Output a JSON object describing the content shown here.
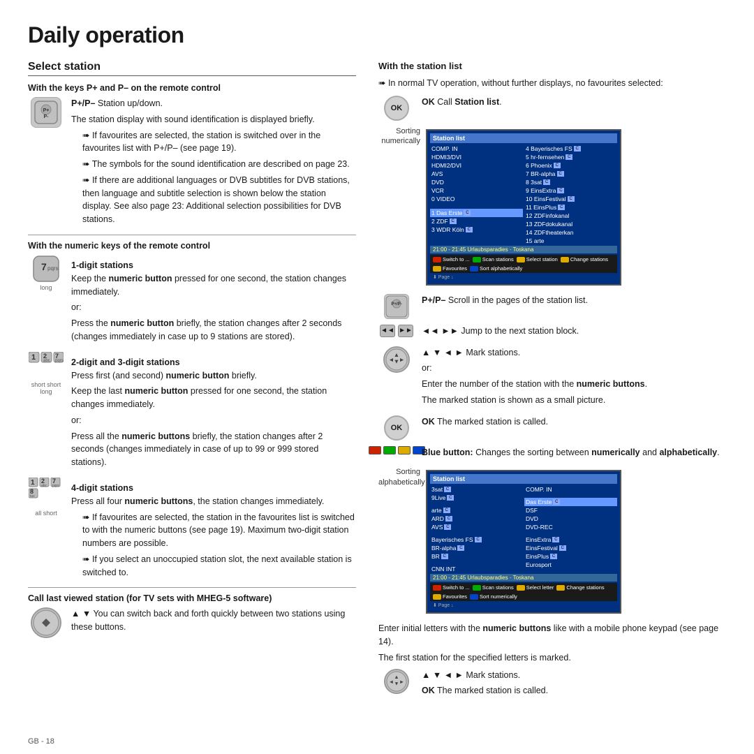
{
  "page": {
    "title": "Daily operation",
    "section": "Select station",
    "page_number": "GB - 18"
  },
  "left": {
    "keys_section_title": "With the keys P+ and P– on the remote control",
    "p_plus_minus": "P+/P–",
    "p_plus_minus_desc": " Station up/down.",
    "station_display": "The station display with sound identification is displayed briefly.",
    "bullet1": "If favourites are selected, the station is switched over in the favourites list with P+/P– (see page 19).",
    "bullet2": "The symbols for the sound identification are described on page 23.",
    "bullet3": "If there are additional languages or DVB subtitles for DVB stations, then language and subtitle selection is shown below the station display. See also page 23: Additional selection possibilities for DVB stations.",
    "numeric_section_title": "With the numeric keys of the remote control",
    "digit1_title": "1-digit stations",
    "digit1_desc1": "Keep the numeric button pressed for one second, the station changes immediately.",
    "digit1_or": "or:",
    "digit1_desc2": "Press the numeric button briefly, the station changes after 2 seconds (changes immediately in case up to 9 stations are stored).",
    "digit23_title": "2-digit and 3-digit stations",
    "digit23_desc1": "Press first (and second) numeric button briefly.",
    "digit23_desc2": "Keep the last numeric button pressed for one second, the station changes immediately.",
    "digit23_or": "or:",
    "digit23_desc3": "Press all the numeric buttons briefly, the station changes after 2 seconds (changes immediately in case of up to 99 or 999 stored stations).",
    "digit4_title": "4-digit stations",
    "digit4_desc1": "Press all four numeric buttons, the station changes immediately.",
    "digit4_bullet1": "If favourites are selected, the station in the favourites list is switched to with the numeric buttons (see page 19). Maximum two-digit station numbers are possible.",
    "digit4_bullet2": "If you select an unoccupied station slot, the next available station is switched to.",
    "call_last_title": "Call last viewed station (for TV sets with MHEG-5 software)",
    "call_last_desc": "You can switch back and forth quickly between two stations using these buttons."
  },
  "right": {
    "station_list_title": "With the station list",
    "normal_tv_desc": "In normal TV operation, without further displays, no favourites selected:",
    "ok_call": "OK",
    "ok_call_desc": "Call Station list.",
    "sorting_numerically": "Sorting\nnumerically",
    "station_list_screen1": {
      "header": "Station list",
      "left_col": [
        "COMP. IN",
        "HDMI3/DVI",
        "HDMI2/DVI",
        "AVS",
        "DVD",
        "VCR",
        "0 VIDEO",
        "",
        "1 Das Erste",
        "2 ZDF",
        "3 WDR Köln"
      ],
      "right_col": [
        "4 Bayerisches FS",
        "5 hr-fernsehen",
        "6 Phoenix",
        "7 BR-alpha",
        "8 3sat",
        "9 EinsExtra",
        "10 EinsFestival",
        "11 EinsPlus",
        "12 ZDFinfokanal",
        "13 ZDFdokukanal",
        "14 ZDFtheaterkan",
        "15 arte"
      ],
      "status": "21:00 - 21:45  Urlaubsparadies · Toskana",
      "footer": [
        "Switch to ...",
        "Scan stations",
        "Select station",
        "Change stations",
        "Favourites",
        "Sort alphabetically"
      ]
    },
    "pp_scroll": "P+/P–",
    "pp_scroll_desc": " Scroll in the pages of the station list.",
    "jump_desc": "◄◄ ►► Jump to the next station block.",
    "mark_desc": "▲ ▼ ◄ ► Mark stations.",
    "or2": "or:",
    "enter_number_desc": "Enter the number of the station with the numeric buttons.",
    "marked_small": "The marked station is shown as a small picture.",
    "ok_marked": "OK",
    "ok_marked_desc": " The marked station is called.",
    "blue_button_desc": "Blue button: Changes the sorting between numerically and alphabetically.",
    "sorting_alphabetically": "Sorting\nalphabetically",
    "station_list_screen2": {
      "header": "Station list",
      "left_col": [
        "3sat",
        "9Live",
        "",
        "arte",
        "ARD",
        "AVS",
        "",
        "Bayerisches FS",
        "BR-alpha",
        "BR",
        "",
        "CNN INT"
      ],
      "right_col": [
        "COMP. IN",
        "",
        "Das Erste",
        "DSF",
        "DVD",
        "DVD-REC",
        "",
        "EinsExtra",
        "EinsFestival",
        "EinsPlus",
        "Eurosport",
        ""
      ],
      "status": "21:00 - 21:45  Urlaubsparadies · Toskana",
      "footer": [
        "Switch to ...",
        "Scan stations",
        "Select letter",
        "Change stations",
        "Favourites",
        "Sort numerically"
      ]
    },
    "enter_letters_desc": "Enter initial letters with the numeric buttons like with a mobile phone keypad (see page 14).",
    "first_station_desc": "The first station for the specified letters is marked.",
    "mark_desc2": "▲ ▼ ◄ ► Mark stations.",
    "ok_call2": "OK",
    "ok_desc2": " The marked station is called."
  }
}
